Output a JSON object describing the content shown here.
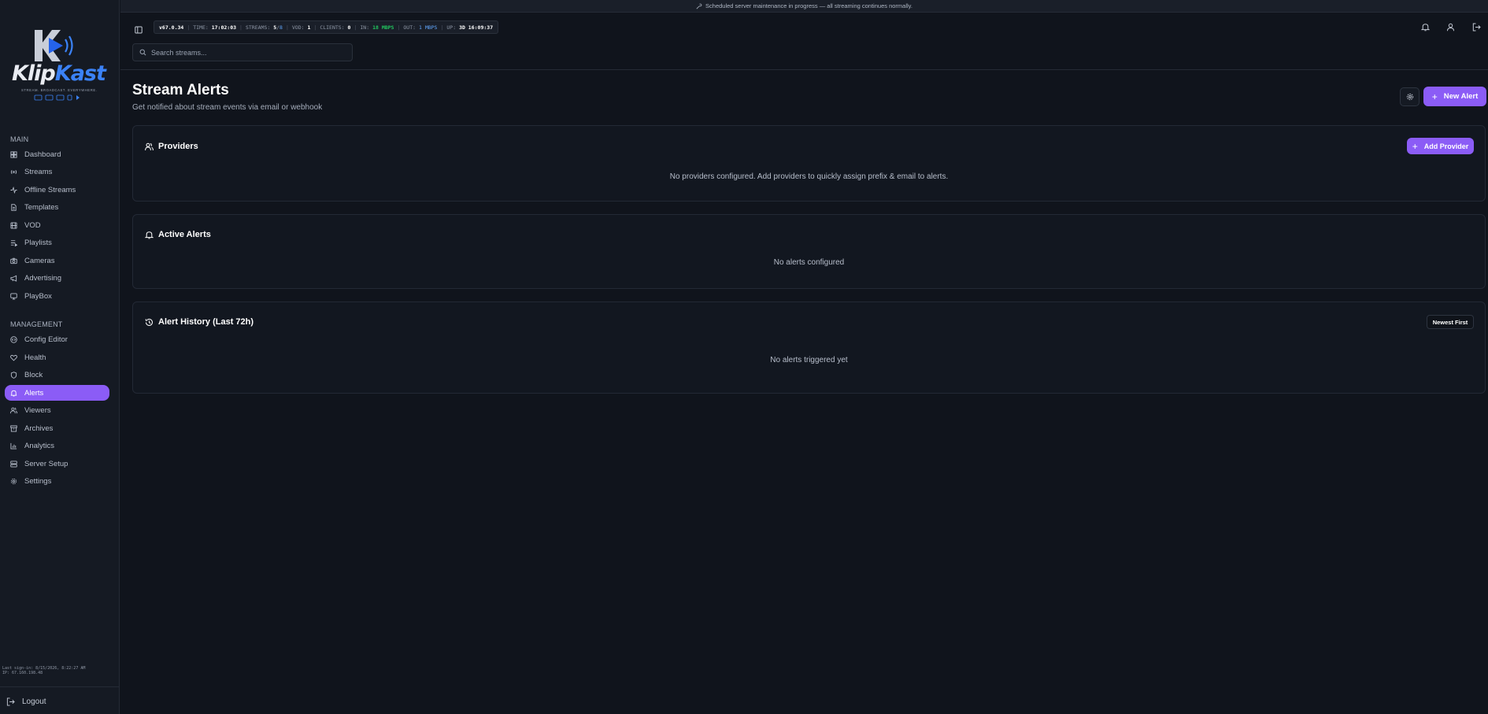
{
  "banner": {
    "text": "Scheduled server maintenance in progress — all streaming continues normally."
  },
  "brand": {
    "name_part1": "Klip",
    "name_part2": "Kast",
    "tagline": "STREAM. BROADCAST. EVERYWHERE."
  },
  "sidebar": {
    "main_label": "MAIN",
    "main_items": [
      {
        "label": "Dashboard",
        "icon": "dashboard-icon"
      },
      {
        "label": "Streams",
        "icon": "broadcast-icon"
      },
      {
        "label": "Offline Streams",
        "icon": "activity-icon"
      },
      {
        "label": "Templates",
        "icon": "file-icon"
      },
      {
        "label": "VOD",
        "icon": "film-icon"
      },
      {
        "label": "Playlists",
        "icon": "playlist-icon"
      },
      {
        "label": "Cameras",
        "icon": "camera-icon"
      },
      {
        "label": "Advertising",
        "icon": "megaphone-icon"
      },
      {
        "label": "PlayBox",
        "icon": "monitor-icon"
      }
    ],
    "management_label": "MANAGEMENT",
    "management_items": [
      {
        "label": "Config Editor",
        "icon": "code-icon"
      },
      {
        "label": "Health",
        "icon": "heart-icon"
      },
      {
        "label": "Block",
        "icon": "shield-icon"
      },
      {
        "label": "Alerts",
        "icon": "bell-icon",
        "active": true
      },
      {
        "label": "Viewers",
        "icon": "users-icon"
      },
      {
        "label": "Archives",
        "icon": "archive-icon"
      },
      {
        "label": "Analytics",
        "icon": "bar-chart-icon"
      },
      {
        "label": "Server Setup",
        "icon": "server-icon"
      },
      {
        "label": "Settings",
        "icon": "gear-icon"
      }
    ],
    "last_signin": "Last sign-in: 8/15/2026, 8:22:27 AM",
    "ip": "IP: 67.160.198.48",
    "logout_label": "Logout"
  },
  "stats": {
    "version": "v67.0.34",
    "time_label": "TIME:",
    "time": "17:02:03",
    "streams_label": "STREAMS:",
    "streams_active": "5",
    "streams_total": "8",
    "vod_label": "VOD:",
    "vod": "1",
    "clients_label": "CLIENTS:",
    "clients": "0",
    "in_label": "IN:",
    "in_value": "18",
    "in_unit": "MBPS",
    "out_label": "OUT:",
    "out_value": "1",
    "out_unit": "MBPS",
    "up_label": "UP:",
    "uptime": "3D 16:09:37"
  },
  "search": {
    "placeholder": "Search streams..."
  },
  "page": {
    "title": "Stream Alerts",
    "subtitle": "Get notified about stream events via email or webhook",
    "new_alert_label": "New Alert"
  },
  "providers": {
    "title": "Providers",
    "add_label": "Add Provider",
    "empty": "No providers configured. Add providers to quickly assign prefix & email to alerts."
  },
  "active_alerts": {
    "title": "Active Alerts",
    "empty": "No alerts configured"
  },
  "history": {
    "title": "Alert History (Last 72h)",
    "sort_label": "Newest First",
    "empty": "No alerts triggered yet"
  },
  "colors": {
    "accent": "#8b5cf6",
    "in_rate": "#22c55e",
    "out_rate": "#60a5fa",
    "brand_blue": "#3b82f6"
  }
}
